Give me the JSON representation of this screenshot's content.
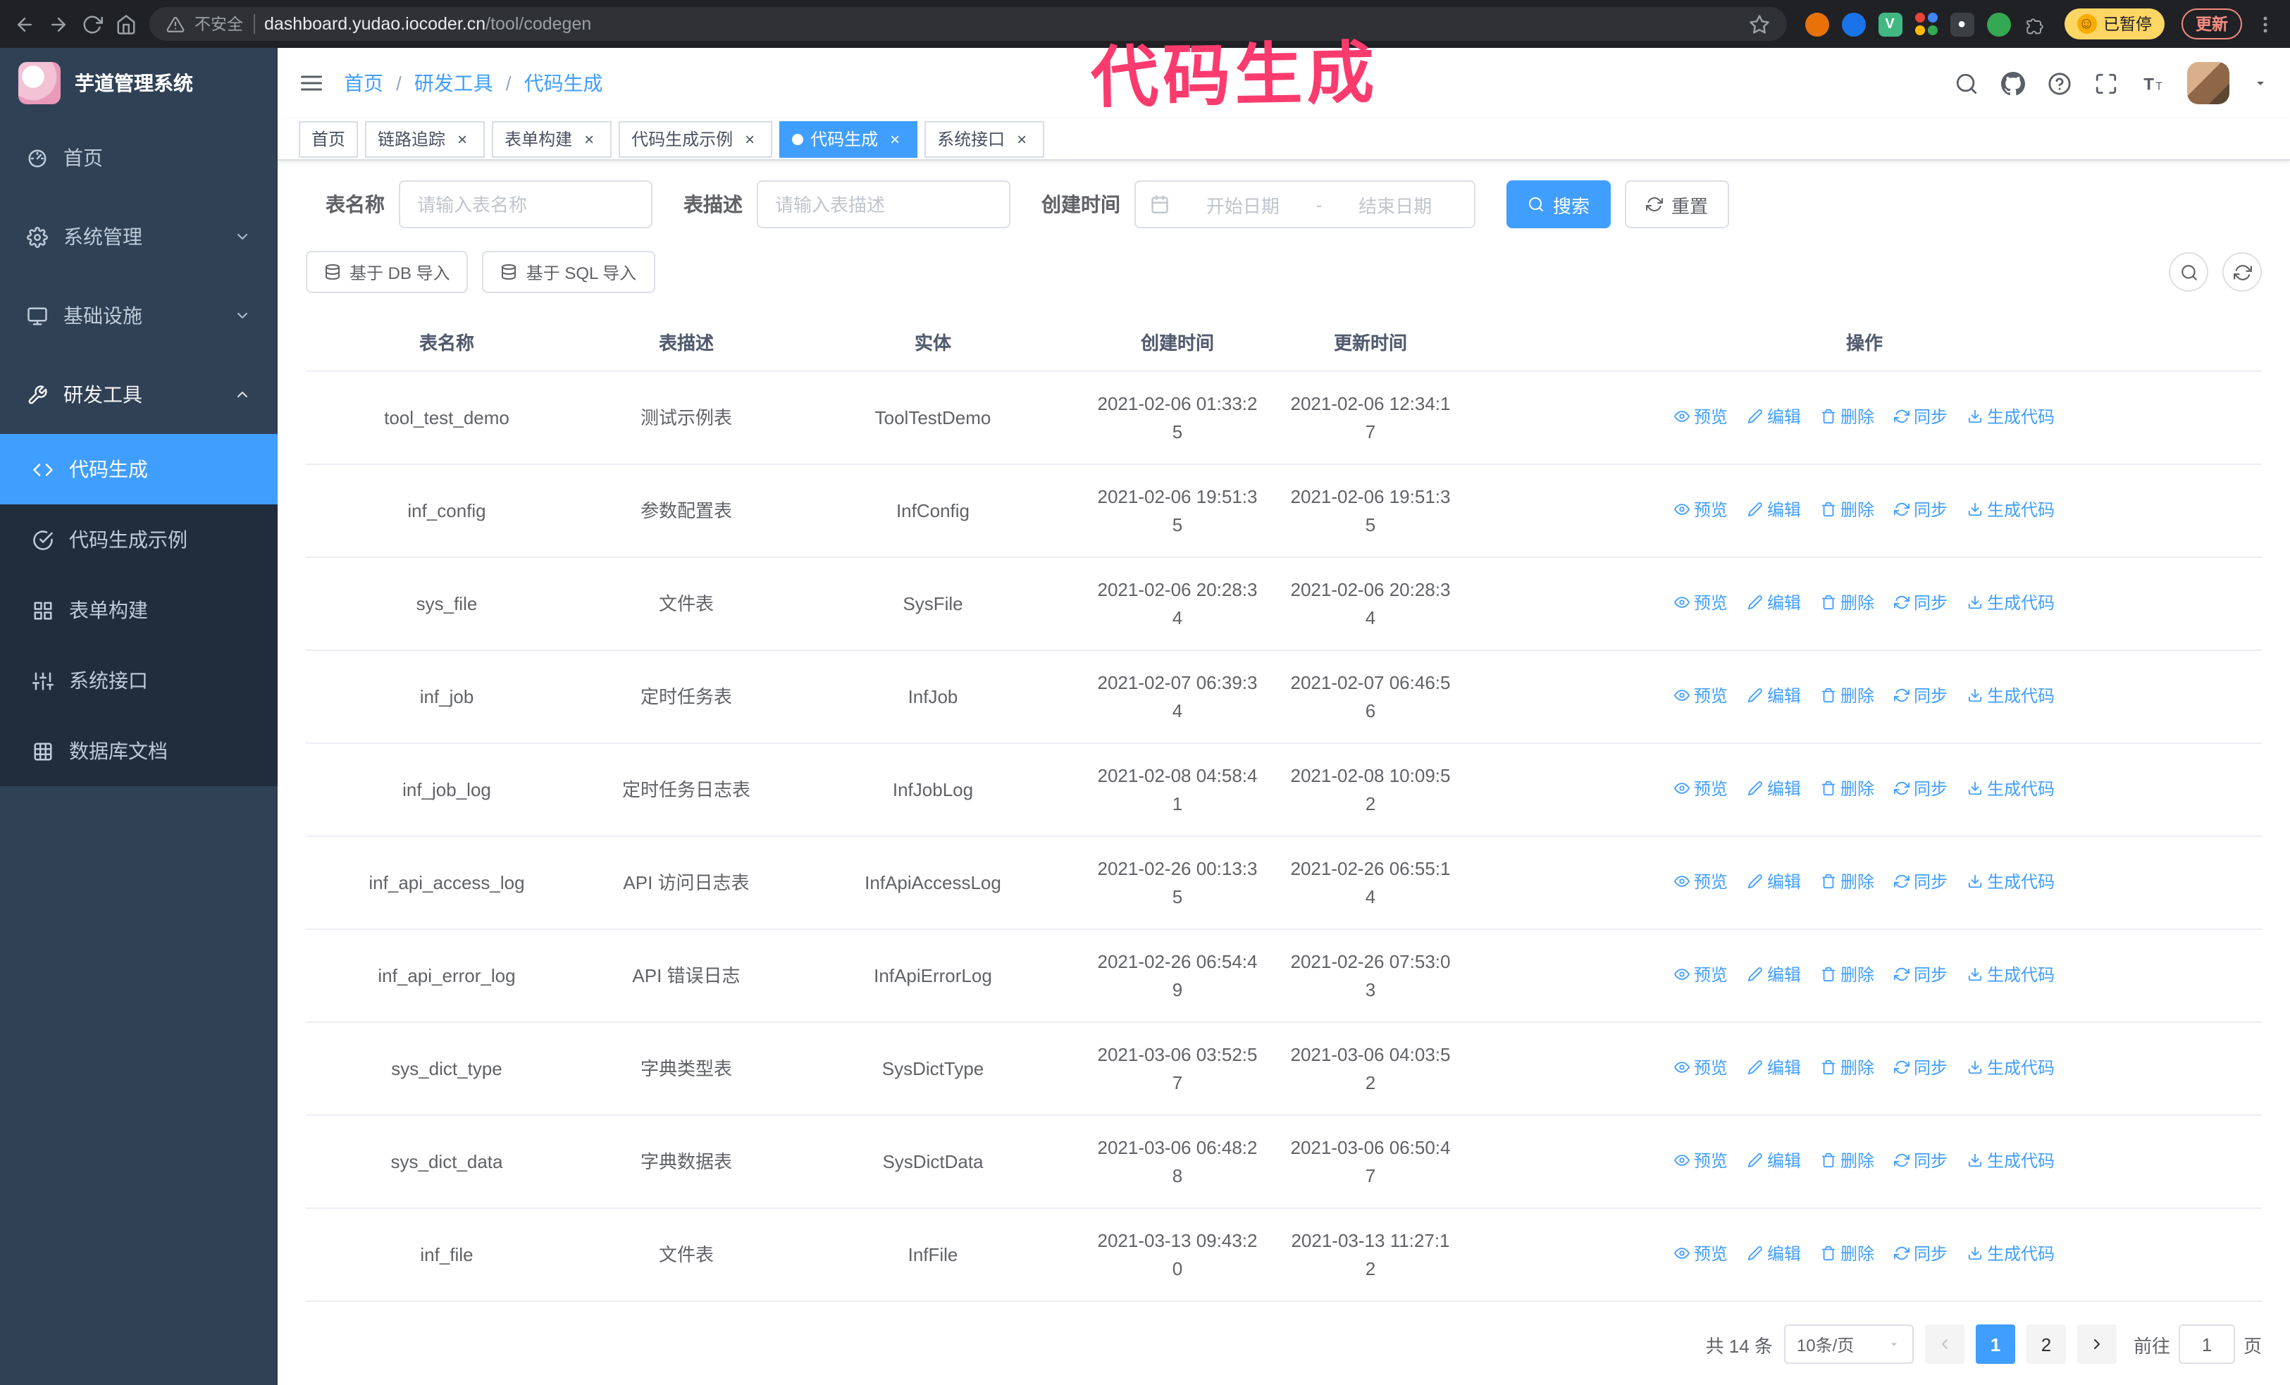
{
  "theme": {
    "primary": "#409eff",
    "sidebar_bg": "#304156",
    "submenu_bg": "#1f2d3d",
    "browser_bg": "#202124",
    "annotation_color": "#fb3b6e"
  },
  "annotation": {
    "text": "代码生成"
  },
  "browser": {
    "nav_icons": [
      "back-icon",
      "forward-icon",
      "reload-icon",
      "home-icon"
    ],
    "security_label": "不安全",
    "url_host": "dashboard.yudao.iocoder.cn",
    "url_path": "/tool/codegen",
    "profile_emoji": "☺",
    "profile_badge": "已暂停",
    "update_button": "更新",
    "extensions": [
      {
        "name": "extension-orange-icon",
        "kind": "circle",
        "color": "#e8710a"
      },
      {
        "name": "extension-blue-icon",
        "kind": "circle",
        "color": "#1a73e8"
      },
      {
        "name": "extension-vue-icon",
        "kind": "square",
        "color": "#41b883",
        "label": "V"
      },
      {
        "name": "extension-avatars-grid-icon",
        "kind": "grid",
        "colors": [
          "#ea4335",
          "#4285f4",
          "#fbbc04",
          "#34a853"
        ]
      },
      {
        "name": "extension-recorder-icon",
        "kind": "square",
        "color": "#3c4043",
        "label": "●"
      },
      {
        "name": "extension-green-icon",
        "kind": "circle",
        "color": "#34a853"
      },
      {
        "name": "extension-puzzle-icon",
        "kind": "puzzle",
        "color": "#9aa0a6"
      }
    ]
  },
  "sidebar": {
    "logo_title": "芋道管理系统",
    "items": [
      {
        "id": "home",
        "label": "首页",
        "icon": "dashboard-icon"
      },
      {
        "id": "system",
        "label": "系统管理",
        "icon": "gear-icon",
        "chevron": "down"
      },
      {
        "id": "infra",
        "label": "基础设施",
        "icon": "monitor-icon",
        "chevron": "down"
      },
      {
        "id": "devtools",
        "label": "研发工具",
        "icon": "tool-icon",
        "chevron": "up",
        "children": [
          {
            "id": "codegen",
            "label": "代码生成",
            "icon": "code-icon",
            "active": true
          },
          {
            "id": "codegen-example",
            "label": "代码生成示例",
            "icon": "badge-icon"
          },
          {
            "id": "form-builder",
            "label": "表单构建",
            "icon": "grid-icon"
          },
          {
            "id": "api",
            "label": "系统接口",
            "icon": "sliders-icon"
          },
          {
            "id": "db-doc",
            "label": "数据库文档",
            "icon": "table-icon"
          }
        ]
      }
    ]
  },
  "header": {
    "breadcrumb": [
      "首页",
      "研发工具",
      "代码生成"
    ],
    "breadcrumb_separator": "/",
    "icons": [
      "search-icon",
      "github-icon",
      "help-icon",
      "fullscreen-icon",
      "font-size-icon"
    ]
  },
  "tabs_close": "×",
  "tabs": [
    {
      "id": "home",
      "label": "首页",
      "closable": false
    },
    {
      "id": "tracing",
      "label": "链路追踪",
      "closable": true
    },
    {
      "id": "form-builder",
      "label": "表单构建",
      "closable": true
    },
    {
      "id": "codegen-example",
      "label": "代码生成示例",
      "closable": true
    },
    {
      "id": "codegen",
      "label": "代码生成",
      "closable": true,
      "active": true
    },
    {
      "id": "api",
      "label": "系统接口",
      "closable": true
    }
  ],
  "filters": {
    "table_name_label": "表名称",
    "table_name_placeholder": "请输入表名称",
    "table_desc_label": "表描述",
    "table_desc_placeholder": "请输入表描述",
    "create_time_label": "创建时间",
    "date_start_placeholder": "开始日期",
    "date_separator": "-",
    "date_end_placeholder": "结束日期",
    "search_button": "搜索",
    "reset_button": "重置"
  },
  "toolbar": {
    "import_db": "基于 DB 导入",
    "import_sql": "基于 SQL 导入",
    "tools": [
      {
        "name": "table-search-toggle-button",
        "icon": "search-icon"
      },
      {
        "name": "table-refresh-button",
        "icon": "refresh-icon"
      }
    ]
  },
  "table": {
    "columns": [
      "表名称",
      "表描述",
      "实体",
      "创建时间",
      "更新时间",
      "操作"
    ],
    "actions": [
      {
        "label": "预览",
        "icon": "eye-icon",
        "name": "preview-link"
      },
      {
        "label": "编辑",
        "icon": "edit-icon",
        "name": "edit-link"
      },
      {
        "label": "删除",
        "icon": "trash-icon",
        "name": "delete-link"
      },
      {
        "label": "同步",
        "icon": "sync-icon",
        "name": "sync-link"
      },
      {
        "label": "生成代码",
        "icon": "download-icon",
        "name": "generate-code-link"
      }
    ],
    "rows": [
      {
        "name": "tool_test_demo",
        "desc": "测试示例表",
        "entity": "ToolTestDemo",
        "created": "2021-02-06 01:33:25",
        "updated": "2021-02-06 12:34:17"
      },
      {
        "name": "inf_config",
        "desc": "参数配置表",
        "entity": "InfConfig",
        "created": "2021-02-06 19:51:35",
        "updated": "2021-02-06 19:51:35"
      },
      {
        "name": "sys_file",
        "desc": "文件表",
        "entity": "SysFile",
        "created": "2021-02-06 20:28:34",
        "updated": "2021-02-06 20:28:34"
      },
      {
        "name": "inf_job",
        "desc": "定时任务表",
        "entity": "InfJob",
        "created": "2021-02-07 06:39:34",
        "updated": "2021-02-07 06:46:56"
      },
      {
        "name": "inf_job_log",
        "desc": "定时任务日志表",
        "entity": "InfJobLog",
        "created": "2021-02-08 04:58:41",
        "updated": "2021-02-08 10:09:52"
      },
      {
        "name": "inf_api_access_log",
        "desc": "API 访问日志表",
        "entity": "InfApiAccessLog",
        "created": "2021-02-26 00:13:35",
        "updated": "2021-02-26 06:55:14"
      },
      {
        "name": "inf_api_error_log",
        "desc": "API 错误日志",
        "entity": "InfApiErrorLog",
        "created": "2021-02-26 06:54:49",
        "updated": "2021-02-26 07:53:03"
      },
      {
        "name": "sys_dict_type",
        "desc": "字典类型表",
        "entity": "SysDictType",
        "created": "2021-03-06 03:52:57",
        "updated": "2021-03-06 04:03:52"
      },
      {
        "name": "sys_dict_data",
        "desc": "字典数据表",
        "entity": "SysDictData",
        "created": "2021-03-06 06:48:28",
        "updated": "2021-03-06 06:50:47"
      },
      {
        "name": "inf_file",
        "desc": "文件表",
        "entity": "InfFile",
        "created": "2021-03-13 09:43:20",
        "updated": "2021-03-13 11:27:12"
      }
    ]
  },
  "pagination": {
    "total": "共 14 条",
    "page_size": "10条/页",
    "pages": [
      "1",
      "2"
    ],
    "active_page": "1",
    "goto_label": "前往",
    "goto_value": "1",
    "goto_suffix": "页"
  }
}
